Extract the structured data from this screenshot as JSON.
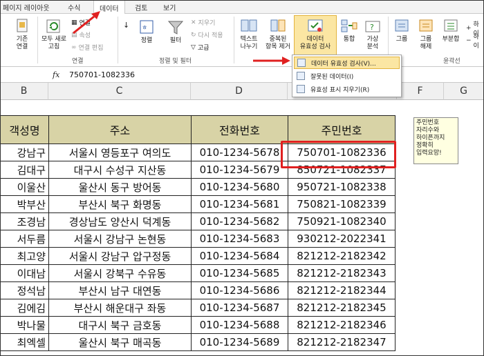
{
  "tabs": [
    "페이지 레이아웃",
    "수식",
    "데이터",
    "검토",
    "보기"
  ],
  "ribbon": {
    "refresh_all": "모두 새로\n고침",
    "connections": "연결",
    "properties": "속성",
    "edit_links": "연결 편집",
    "from_other": "기존\n연결",
    "sort_az": "",
    "sort": "정렬",
    "filter": "필터",
    "clear": "지우기",
    "reapply": "다시 적용",
    "advanced": "고급",
    "text_to_columns": "텍스트\n나누기",
    "remove_duplicates": "중복된\n항목 제거",
    "data_validation": "데이터\n유효성 검사",
    "consolidate": "통합",
    "what_if": "가상\n분석",
    "group": "그룹",
    "ungroup": "그룹\n해제",
    "subtotal": "부분합",
    "show_detail": "하이",
    "hide_detail": "하이",
    "group_connections": "연결",
    "group_sort_filter": "정렬 및 필터",
    "group_outline": "윤곽선"
  },
  "menu": [
    "데이터 유효성 검사(V)...",
    "잘못된 데이터(I)",
    "유효성 표시 지우기(R)"
  ],
  "formula_bar": {
    "fx": "fx",
    "value": "750701-1082336"
  },
  "columns": [
    "B",
    "C",
    "D",
    "E",
    "F",
    "G"
  ],
  "table": {
    "headers": [
      "객성명",
      "주소",
      "전화번호",
      "주민번호"
    ],
    "rows": [
      [
        "강남구",
        "서울시 영등포구 여의도",
        "010-1234-5678",
        "750701-1082336"
      ],
      [
        "김대구",
        "대구시 수성구 지산동",
        "010-1234-5679",
        "850721-1082337"
      ],
      [
        "이울산",
        "울산시 동구 방어동",
        "010-1234-5680",
        "950721-1082338"
      ],
      [
        "박부산",
        "부산시 북구 화명동",
        "010-1234-5681",
        "750821-1082339"
      ],
      [
        "조경남",
        "경상남도 양산시 덕계동",
        "010-1234-5682",
        "750921-1082340"
      ],
      [
        "서두름",
        "서울시 강남구 논현동",
        "010-1234-5683",
        "930212-2022341"
      ],
      [
        "최고양",
        "서울시 강남구 압구정동",
        "010-1234-5684",
        "821212-2182342"
      ],
      [
        "이대남",
        "서울시 강북구 수유동",
        "010-1234-5685",
        "821212-2182343"
      ],
      [
        "정석남",
        "부산시 남구 대연동",
        "010-1234-5686",
        "821212-2182344"
      ],
      [
        "김에김",
        "부산시 해운대구 좌동",
        "010-1234-5687",
        "821212-2182345"
      ],
      [
        "박나물",
        "대구시 북구 금호동",
        "010-1234-5688",
        "821212-2182346"
      ],
      [
        "최엑셀",
        "울산시 북구 매곡동",
        "010-1234-5689",
        "821212-2182347"
      ]
    ]
  },
  "comment": [
    "주민번호",
    "자리수와",
    "하이픈까지",
    "정확히",
    "입력요망!"
  ],
  "colors": {
    "header_fill": "#d8d3a6",
    "highlight": "#fbe6a3",
    "arrow": "#e02020"
  }
}
